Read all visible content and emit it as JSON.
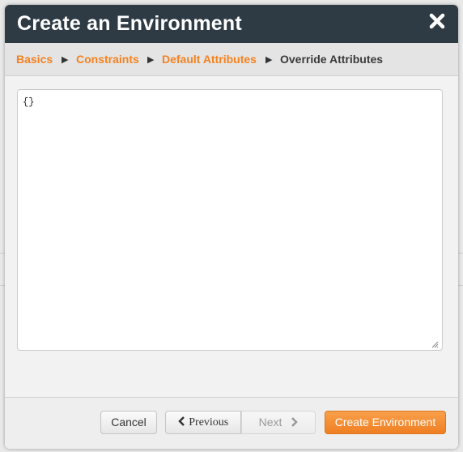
{
  "modal": {
    "title": "Create an Environment"
  },
  "breadcrumbs": [
    {
      "label": "Basics",
      "state": "link"
    },
    {
      "label": "Constraints",
      "state": "link"
    },
    {
      "label": "Default Attributes",
      "state": "link"
    },
    {
      "label": "Override Attributes",
      "state": "current"
    }
  ],
  "editor": {
    "value": "{}"
  },
  "footer": {
    "cancel_label": "Cancel",
    "previous_label": "Previous",
    "next_label": "Next",
    "create_label": "Create Environment"
  },
  "colors": {
    "header_bg": "#2e3b44",
    "accent": "#f58220",
    "primary_button": "#ef7f22"
  },
  "icons": {
    "close": "close-icon",
    "breadcrumb_separator": "triangle-right-icon",
    "previous": "chevron-left-icon",
    "next": "chevron-right-icon"
  }
}
